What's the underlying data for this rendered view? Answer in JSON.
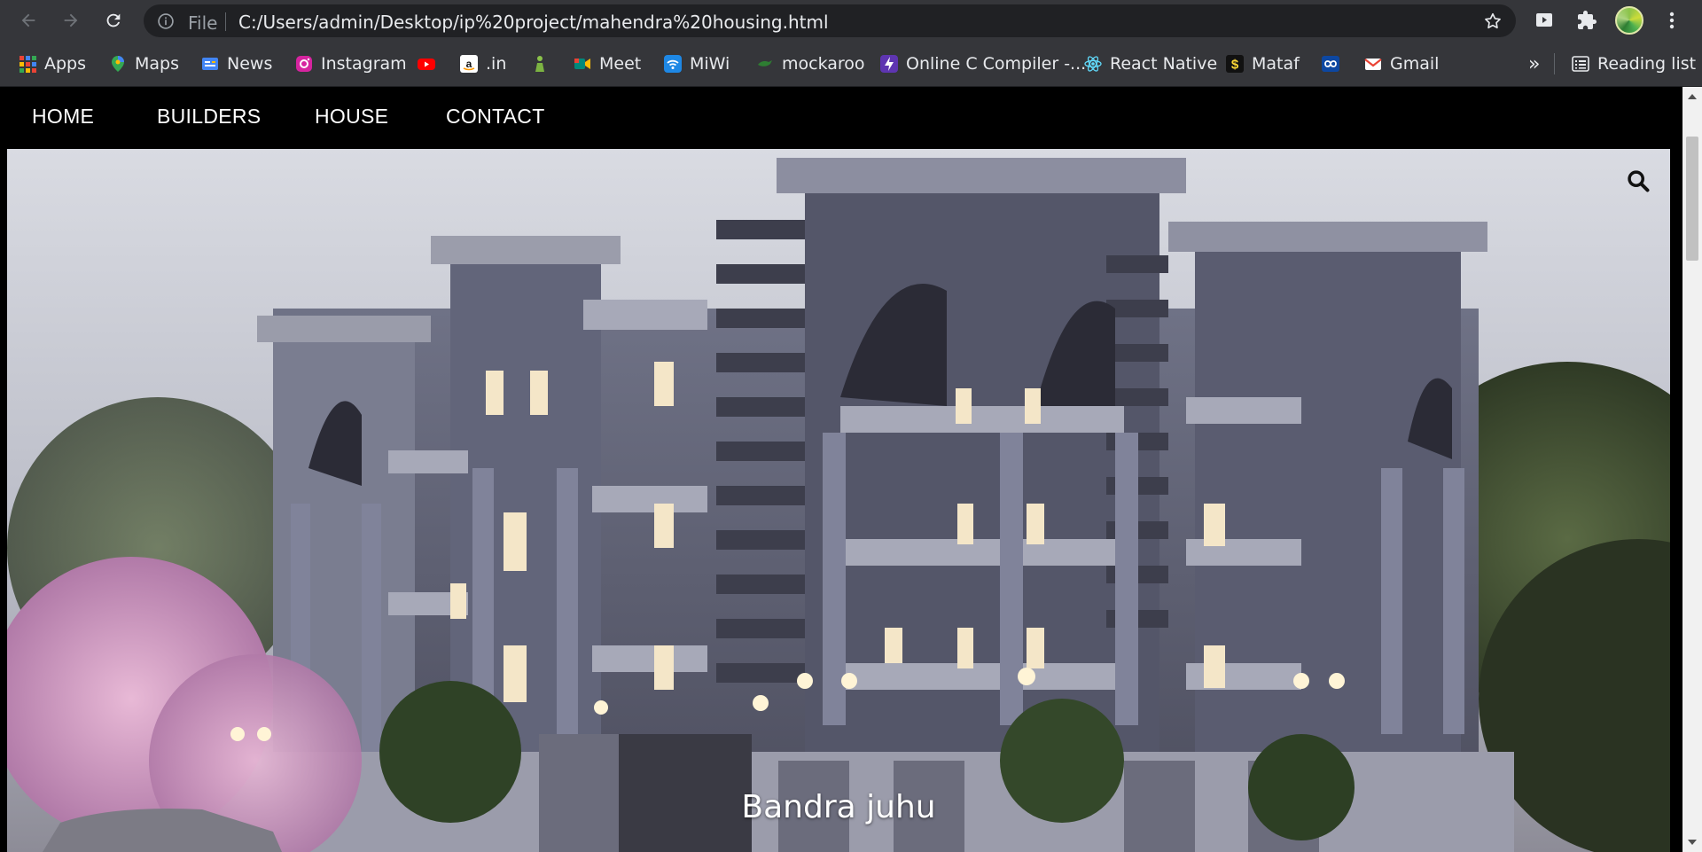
{
  "browser": {
    "file_label": "File",
    "url": "C:/Users/admin/Desktop/ip%20project/mahendra%20housing.html",
    "bookmarks": [
      {
        "label": "Apps",
        "icon": "apps-grid-icon"
      },
      {
        "label": "Maps",
        "icon": "maps-pin-icon"
      },
      {
        "label": "News",
        "icon": "news-icon"
      },
      {
        "label": "Instagram",
        "icon": "instagram-icon"
      },
      {
        "label": "",
        "icon": "youtube-icon"
      },
      {
        "label": ".in",
        "icon": "amazon-icon"
      },
      {
        "label": "",
        "icon": "figure-icon"
      },
      {
        "label": "Meet",
        "icon": "meet-icon"
      },
      {
        "label": "MiWi",
        "icon": "wifi-icon"
      },
      {
        "label": "mockaroo",
        "icon": "mockaroo-icon"
      },
      {
        "label": "Online C Compiler -...",
        "icon": "bolt-icon"
      },
      {
        "label": "React Native",
        "icon": "react-icon"
      },
      {
        "label": "Mataf",
        "icon": "dollar-icon"
      },
      {
        "label": "",
        "icon": "infinity-icon"
      },
      {
        "label": "Gmail",
        "icon": "gmail-icon"
      }
    ],
    "overflow_label": "»",
    "reading_list_label": "Reading list"
  },
  "site": {
    "nav": [
      {
        "label": "HOME"
      },
      {
        "label": "BUILDERS"
      },
      {
        "label": "HOUSE"
      },
      {
        "label": "CONTACT"
      }
    ],
    "hero_caption": "Bandra juhu"
  },
  "colors": {
    "chrome_bg": "#35363a",
    "omnibox_bg": "#202124",
    "nav_bg": "#000000",
    "nav_text": "#ffffff"
  }
}
